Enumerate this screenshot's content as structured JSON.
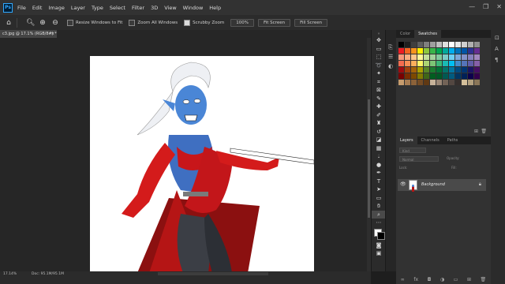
{
  "menu": {
    "logo": "Ps",
    "items": [
      "File",
      "Edit",
      "Image",
      "Layer",
      "Type",
      "Select",
      "Filter",
      "3D",
      "View",
      "Window",
      "Help"
    ],
    "window_controls": [
      "—",
      "❐",
      "✕"
    ]
  },
  "options": {
    "resize_windows": "Resize Windows to Fit",
    "zoom_all": "Zoom All Windows",
    "scrubby_zoom": "Scrubby Zoom",
    "btn_100": "100%",
    "btn_fit": "Fit Screen",
    "btn_fill": "Fill Screen"
  },
  "document": {
    "tab_title": "c3.jpg @ 17.1% (RGB/8#) *",
    "close": "×"
  },
  "status": {
    "zoom": "17.14%",
    "doc": "Doc: 95.1M/95.1M"
  },
  "panels": {
    "color_tab": "Color",
    "swatches_tab": "Swatches",
    "layers_tab": "Layers",
    "channels_tab": "Channels",
    "paths_tab": "Paths",
    "kind_placeholder": "Kind",
    "normal": "Normal",
    "opacity": "Opacity:",
    "lock": "Lock:",
    "fill": "Fill:",
    "layer_name": "Background"
  },
  "swatch_colors": [
    "#000000",
    "#1f1f1f",
    "#3f3f3f",
    "#5f5f5f",
    "#7f7f7f",
    "#9f9f9f",
    "#bfbfbf",
    "#dfdfdf",
    "#ffffff",
    "#e8e8e8",
    "#d0d0d0",
    "#b0b0b0",
    "#909090",
    "#ed1c24",
    "#f26522",
    "#f7941d",
    "#fff200",
    "#8dc63f",
    "#39b54a",
    "#00a651",
    "#00a99d",
    "#00aeef",
    "#0072bc",
    "#0054a6",
    "#2e3192",
    "#662d91",
    "#f7977a",
    "#f9ad81",
    "#fdc68a",
    "#fff79a",
    "#c4df9b",
    "#a3d39c",
    "#82ca9d",
    "#7accc8",
    "#6dcff6",
    "#7da7d9",
    "#8393ca",
    "#8781bd",
    "#a187be",
    "#f26c4f",
    "#f68e55",
    "#fbaf5c",
    "#fff467",
    "#acd372",
    "#7cc576",
    "#3bb878",
    "#1abbb4",
    "#00bff3",
    "#438ccb",
    "#5574b9",
    "#605ca8",
    "#855fa8",
    "#9e0b0f",
    "#a0410d",
    "#a3620a",
    "#aba000",
    "#598527",
    "#1a7b30",
    "#007236",
    "#00746b",
    "#0076a3",
    "#004b80",
    "#003471",
    "#1b1464",
    "#440e62",
    "#790000",
    "#7b2e00",
    "#7d4900",
    "#827b00",
    "#406618",
    "#005e20",
    "#005826",
    "#005952",
    "#005b7f",
    "#003663",
    "#002157",
    "#0d004c",
    "#32004b",
    "#c69c6d",
    "#a67c52",
    "#8c6239",
    "#754c24",
    "#603913",
    "#c7b299",
    "#998675",
    "#736357",
    "#534741",
    "#362f2d",
    "#d4bf9a",
    "#b3a07e",
    "#8a7658"
  ]
}
